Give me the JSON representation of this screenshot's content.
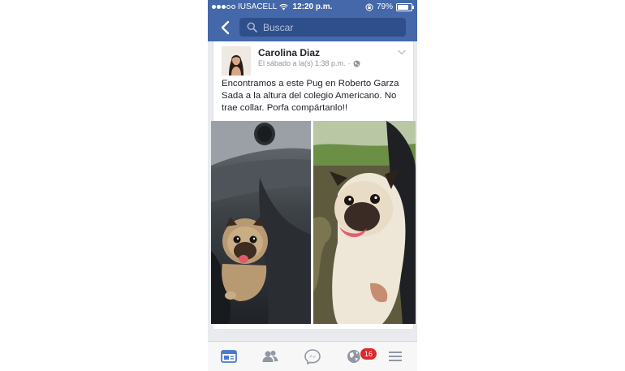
{
  "status_bar": {
    "carrier": "IUSACELL",
    "time": "12:20 p.m.",
    "battery": "79%",
    "battery_level": 0.79
  },
  "search": {
    "placeholder": "Buscar"
  },
  "post": {
    "author": "Carolina Diaz",
    "timestamp": "El sábado a la(s) 1:38 p.m.",
    "separator": "·",
    "privacy_icon": "globe-icon",
    "text": "Encontramos a este Pug en Roberto Garza Sada a la altura del colegio Americano. No trae collar. Porfa compártanlo!!"
  },
  "tab_bar": {
    "items": [
      "news-feed-icon",
      "friends-icon",
      "messenger-icon",
      "notifications-globe-icon",
      "menu-icon"
    ],
    "active": "news-feed-icon",
    "notifications_badge": "16"
  },
  "colors": {
    "facebook_blue": "#4468a9",
    "search_bg": "#2e4f8c",
    "active_tab": "#4a7ac9",
    "inactive_tab": "#9197a3",
    "badge": "#e0262e"
  }
}
